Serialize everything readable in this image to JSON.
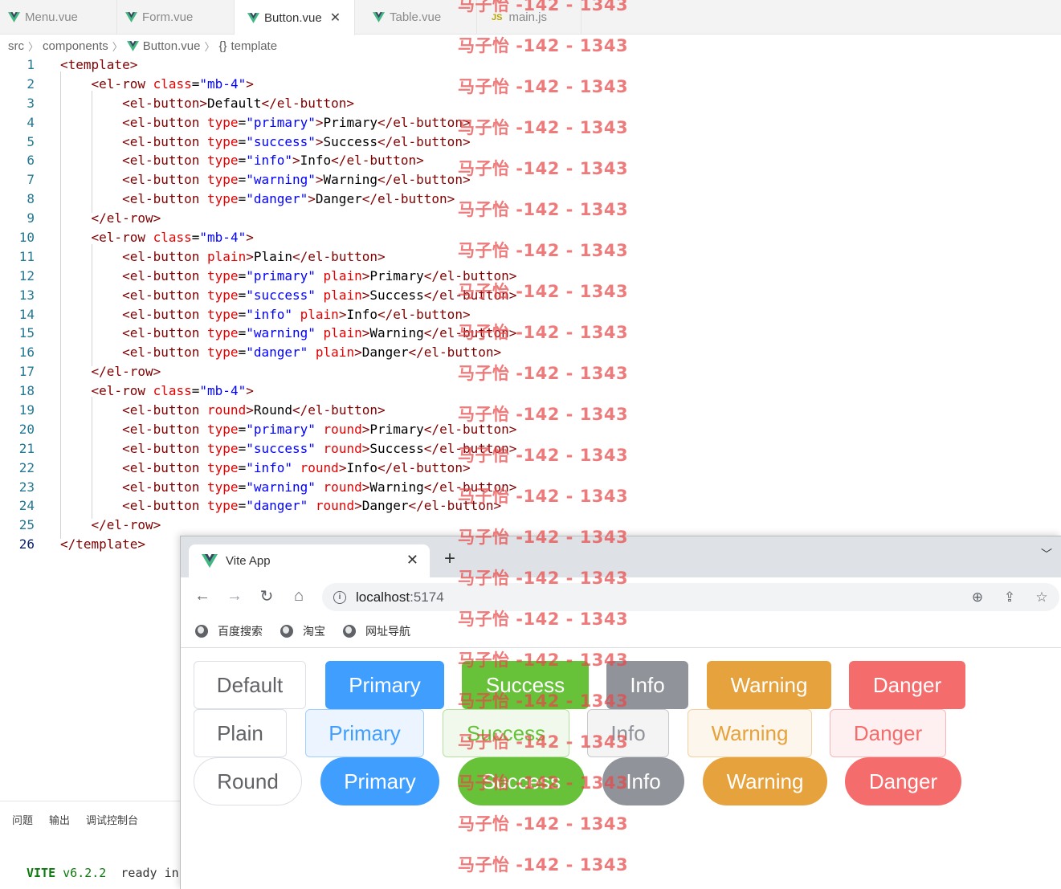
{
  "editor": {
    "tabs": [
      {
        "label": "Menu.vue",
        "icon": "vue-icon"
      },
      {
        "label": "Form.vue",
        "icon": "vue-icon"
      },
      {
        "label": "Button.vue",
        "icon": "vue-icon",
        "active": true
      },
      {
        "label": "Table.vue",
        "icon": "vue-icon"
      },
      {
        "label": "main.js",
        "icon": "js-icon",
        "icon_text": "JS"
      }
    ],
    "breadcrumb": [
      "src",
      "components",
      "Button.vue",
      "template"
    ],
    "current_line": 26
  },
  "code_lines": [
    [
      [
        "t-tag",
        "<template>"
      ]
    ],
    [
      [
        "t-tag",
        "    <el-row "
      ],
      [
        "t-attr",
        "class"
      ],
      [
        "t-txt",
        "="
      ],
      [
        "t-str",
        "\"mb-4\""
      ],
      [
        "t-tag",
        ">"
      ]
    ],
    [
      [
        "t-tag",
        "        <el-button>"
      ],
      [
        "t-txt",
        "Default"
      ],
      [
        "t-tag",
        "</el-button>"
      ]
    ],
    [
      [
        "t-tag",
        "        <el-button "
      ],
      [
        "t-attr",
        "type"
      ],
      [
        "t-txt",
        "="
      ],
      [
        "t-str",
        "\"primary\""
      ],
      [
        "t-tag",
        ">"
      ],
      [
        "t-txt",
        "Primary"
      ],
      [
        "t-tag",
        "</el-button>"
      ]
    ],
    [
      [
        "t-tag",
        "        <el-button "
      ],
      [
        "t-attr",
        "type"
      ],
      [
        "t-txt",
        "="
      ],
      [
        "t-str",
        "\"success\""
      ],
      [
        "t-tag",
        ">"
      ],
      [
        "t-txt",
        "Success"
      ],
      [
        "t-tag",
        "</el-button>"
      ]
    ],
    [
      [
        "t-tag",
        "        <el-button "
      ],
      [
        "t-attr",
        "type"
      ],
      [
        "t-txt",
        "="
      ],
      [
        "t-str",
        "\"info\""
      ],
      [
        "t-tag",
        ">"
      ],
      [
        "t-txt",
        "Info"
      ],
      [
        "t-tag",
        "</el-button>"
      ]
    ],
    [
      [
        "t-tag",
        "        <el-button "
      ],
      [
        "t-attr",
        "type"
      ],
      [
        "t-txt",
        "="
      ],
      [
        "t-str",
        "\"warning\""
      ],
      [
        "t-tag",
        ">"
      ],
      [
        "t-txt",
        "Warning"
      ],
      [
        "t-tag",
        "</el-button>"
      ]
    ],
    [
      [
        "t-tag",
        "        <el-button "
      ],
      [
        "t-attr",
        "type"
      ],
      [
        "t-txt",
        "="
      ],
      [
        "t-str",
        "\"danger\""
      ],
      [
        "t-tag",
        ">"
      ],
      [
        "t-txt",
        "Danger"
      ],
      [
        "t-tag",
        "</el-button>"
      ]
    ],
    [
      [
        "t-tag",
        "    </el-row>"
      ]
    ],
    [
      [
        "t-tag",
        "    <el-row "
      ],
      [
        "t-attr",
        "class"
      ],
      [
        "t-txt",
        "="
      ],
      [
        "t-str",
        "\"mb-4\""
      ],
      [
        "t-tag",
        ">"
      ]
    ],
    [
      [
        "t-tag",
        "        <el-button "
      ],
      [
        "t-attr",
        "plain"
      ],
      [
        "t-tag",
        ">"
      ],
      [
        "t-txt",
        "Plain"
      ],
      [
        "t-tag",
        "</el-button>"
      ]
    ],
    [
      [
        "t-tag",
        "        <el-button "
      ],
      [
        "t-attr",
        "type"
      ],
      [
        "t-txt",
        "="
      ],
      [
        "t-str",
        "\"primary\""
      ],
      [
        "t-txt",
        " "
      ],
      [
        "t-attr",
        "plain"
      ],
      [
        "t-tag",
        ">"
      ],
      [
        "t-txt",
        "Primary"
      ],
      [
        "t-tag",
        "</el-button>"
      ]
    ],
    [
      [
        "t-tag",
        "        <el-button "
      ],
      [
        "t-attr",
        "type"
      ],
      [
        "t-txt",
        "="
      ],
      [
        "t-str",
        "\"success\""
      ],
      [
        "t-txt",
        " "
      ],
      [
        "t-attr",
        "plain"
      ],
      [
        "t-tag",
        ">"
      ],
      [
        "t-txt",
        "Success"
      ],
      [
        "t-tag",
        "</el-button>"
      ]
    ],
    [
      [
        "t-tag",
        "        <el-button "
      ],
      [
        "t-attr",
        "type"
      ],
      [
        "t-txt",
        "="
      ],
      [
        "t-str",
        "\"info\""
      ],
      [
        "t-txt",
        " "
      ],
      [
        "t-attr",
        "plain"
      ],
      [
        "t-tag",
        ">"
      ],
      [
        "t-txt",
        "Info"
      ],
      [
        "t-tag",
        "</el-button>"
      ]
    ],
    [
      [
        "t-tag",
        "        <el-button "
      ],
      [
        "t-attr",
        "type"
      ],
      [
        "t-txt",
        "="
      ],
      [
        "t-str",
        "\"warning\""
      ],
      [
        "t-txt",
        " "
      ],
      [
        "t-attr",
        "plain"
      ],
      [
        "t-tag",
        ">"
      ],
      [
        "t-txt",
        "Warning"
      ],
      [
        "t-tag",
        "</el-button>"
      ]
    ],
    [
      [
        "t-tag",
        "        <el-button "
      ],
      [
        "t-attr",
        "type"
      ],
      [
        "t-txt",
        "="
      ],
      [
        "t-str",
        "\"danger\""
      ],
      [
        "t-txt",
        " "
      ],
      [
        "t-attr",
        "plain"
      ],
      [
        "t-tag",
        ">"
      ],
      [
        "t-txt",
        "Danger"
      ],
      [
        "t-tag",
        "</el-button>"
      ]
    ],
    [
      [
        "t-tag",
        "    </el-row>"
      ]
    ],
    [
      [
        "t-tag",
        "    <el-row "
      ],
      [
        "t-attr",
        "class"
      ],
      [
        "t-txt",
        "="
      ],
      [
        "t-str",
        "\"mb-4\""
      ],
      [
        "t-tag",
        ">"
      ]
    ],
    [
      [
        "t-tag",
        "        <el-button "
      ],
      [
        "t-attr",
        "round"
      ],
      [
        "t-tag",
        ">"
      ],
      [
        "t-txt",
        "Round"
      ],
      [
        "t-tag",
        "</el-button>"
      ]
    ],
    [
      [
        "t-tag",
        "        <el-button "
      ],
      [
        "t-attr",
        "type"
      ],
      [
        "t-txt",
        "="
      ],
      [
        "t-str",
        "\"primary\""
      ],
      [
        "t-txt",
        " "
      ],
      [
        "t-attr",
        "round"
      ],
      [
        "t-tag",
        ">"
      ],
      [
        "t-txt",
        "Primary"
      ],
      [
        "t-tag",
        "</el-button>"
      ]
    ],
    [
      [
        "t-tag",
        "        <el-button "
      ],
      [
        "t-attr",
        "type"
      ],
      [
        "t-txt",
        "="
      ],
      [
        "t-str",
        "\"success\""
      ],
      [
        "t-txt",
        " "
      ],
      [
        "t-attr",
        "round"
      ],
      [
        "t-tag",
        ">"
      ],
      [
        "t-txt",
        "Success"
      ],
      [
        "t-tag",
        "</el-button>"
      ]
    ],
    [
      [
        "t-tag",
        "        <el-button "
      ],
      [
        "t-attr",
        "type"
      ],
      [
        "t-txt",
        "="
      ],
      [
        "t-str",
        "\"info\""
      ],
      [
        "t-txt",
        " "
      ],
      [
        "t-attr",
        "round"
      ],
      [
        "t-tag",
        ">"
      ],
      [
        "t-txt",
        "Info"
      ],
      [
        "t-tag",
        "</el-button>"
      ]
    ],
    [
      [
        "t-tag",
        "        <el-button "
      ],
      [
        "t-attr",
        "type"
      ],
      [
        "t-txt",
        "="
      ],
      [
        "t-str",
        "\"warning\""
      ],
      [
        "t-txt",
        " "
      ],
      [
        "t-attr",
        "round"
      ],
      [
        "t-tag",
        ">"
      ],
      [
        "t-txt",
        "Warning"
      ],
      [
        "t-tag",
        "</el-button>"
      ]
    ],
    [
      [
        "t-tag",
        "        <el-button "
      ],
      [
        "t-attr",
        "type"
      ],
      [
        "t-txt",
        "="
      ],
      [
        "t-str",
        "\"danger\""
      ],
      [
        "t-txt",
        " "
      ],
      [
        "t-attr",
        "round"
      ],
      [
        "t-tag",
        ">"
      ],
      [
        "t-txt",
        "Danger"
      ],
      [
        "t-tag",
        "</el-button>"
      ]
    ],
    [
      [
        "t-tag",
        "    </el-row>"
      ]
    ],
    [
      [
        "t-tag",
        "</template>"
      ]
    ]
  ],
  "panel": {
    "tabs": [
      "问题",
      "输出",
      "调试控制台"
    ],
    "terminal": {
      "brand": "VITE",
      "version": "v6.2.2",
      "text": "ready in"
    }
  },
  "browser": {
    "tab_title": "Vite App",
    "new_tab": "+",
    "url_host": "localhost",
    "url_port": ":5174",
    "bookmarks": [
      "百度搜索",
      "淘宝",
      "网址导航"
    ]
  },
  "buttons": {
    "rows": [
      [
        {
          "label": "Default",
          "style": "default"
        },
        {
          "label": "Primary",
          "style": "s-primary"
        },
        {
          "label": "Success",
          "style": "s-success"
        },
        {
          "label": "Info",
          "style": "s-info"
        },
        {
          "label": "Warning",
          "style": "s-warning"
        },
        {
          "label": "Danger",
          "style": "s-danger"
        }
      ],
      [
        {
          "label": "Plain",
          "style": "default"
        },
        {
          "label": "Primary",
          "style": "p-primary"
        },
        {
          "label": "Success",
          "style": "p-success"
        },
        {
          "label": "Info",
          "style": "p-info"
        },
        {
          "label": "Warning",
          "style": "p-warning"
        },
        {
          "label": "Danger",
          "style": "p-danger"
        }
      ],
      [
        {
          "label": "Round",
          "style": "default round"
        },
        {
          "label": "Primary",
          "style": "s-primary round"
        },
        {
          "label": "Success",
          "style": "s-success round"
        },
        {
          "label": "Info",
          "style": "s-info round"
        },
        {
          "label": "Warning",
          "style": "s-warning round"
        },
        {
          "label": "Danger",
          "style": "s-danger round"
        }
      ]
    ]
  },
  "colors": {
    "primary": "#409eff",
    "success": "#67c23a",
    "info": "#909399",
    "warning": "#e6a23c",
    "danger": "#f56c6c"
  },
  "watermark": "马子怡 -142 - 1343"
}
